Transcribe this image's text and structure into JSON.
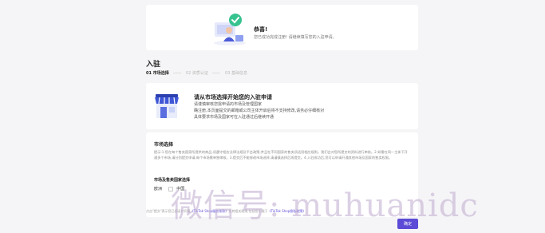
{
  "success": {
    "title": "恭喜!",
    "desc": "您已成功完成注册! 请继续填写您的入驻申请。"
  },
  "apply": {
    "heading": "入驻",
    "steps": [
      {
        "label": "01 市场选择",
        "active": true
      },
      {
        "label": "02 资质认证",
        "active": false
      },
      {
        "label": "03 基础信息",
        "active": false
      }
    ]
  },
  "market": {
    "title": "请从市场选择开始您的入驻申请",
    "lines": [
      "请谨慎审核您需申请的市场及管理国家",
      "确注册,本页面提交的邮箱或公司主体开启后将不支持修改,请务必仔细核对",
      "具体要求市场及国家可在入驻通过后继续开通"
    ]
  },
  "select": {
    "title": "市场选择",
    "notice": "提示:1.您在每个售卖国家所提供的商品,须遵守相应法律法规及平台政策;并且在不同国家的售卖须适用相应规则。我们会对您所提交的资料进行审核。2.如需在同一主体下开通多个市场,请分别提交申请,每个市场需单独审核。3.提交后不能修改市场选择,请谨慎选择后再提交。4.入驻成功后,您可以申请开通其他市场及国家的售卖权限。",
    "sub_title": "市场及售卖国家选择",
    "checkbox_prefix": "欧洲",
    "checkbox_label": "中国"
  },
  "footer": {
    "prefix": "点击\"提交\"表示您已阅读并同意",
    "link1": "《TikTok Shop服务条款》",
    "middle": "及其相关政策,包括但不限于",
    "link2": "《TikTok Shop隐私政策》"
  },
  "next_label": "确定",
  "watermark": "微信号: muhuanidc",
  "colors": {
    "accent": "#5b4bd6",
    "page_bg": "#f5f5f7",
    "card_bg": "#ffffff"
  }
}
